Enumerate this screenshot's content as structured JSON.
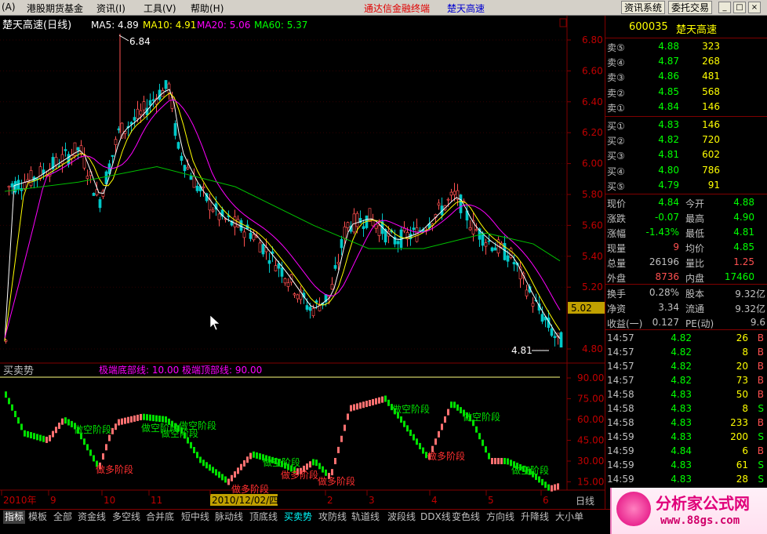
{
  "menubar": {
    "items": [
      "(A)",
      "港股期货基金",
      "资讯(I)",
      "工具(V)",
      "帮助(H)"
    ],
    "brand": "通达信金融终端",
    "stock_title": "楚天高速",
    "btn_info": "资讯系统",
    "btn_trade": "委托交易"
  },
  "chart": {
    "title": "楚天高速(日线)",
    "ma": [
      {
        "label": "MA5: 4.89",
        "color": "#ffffff"
      },
      {
        "label": "MA10: 4.91",
        "color": "#ffff00"
      },
      {
        "label": "MA20: 5.06",
        "color": "#ff00ff"
      },
      {
        "label": "MA60: 5.37",
        "color": "#00ff00"
      }
    ],
    "price_axis": [
      "6.80",
      "6.60",
      "6.40",
      "6.20",
      "6.00",
      "5.80",
      "5.60",
      "5.40",
      "5.20",
      "5.02",
      "4.80"
    ],
    "high_label": "6.84",
    "low_label": "4.81",
    "current_price": "5.02",
    "ind_title": "买卖势",
    "ind_params": "极端底部线: 10.00  极端顶部线: 90.00",
    "ind_axis": [
      "90.00",
      "75.00",
      "60.00",
      "45.00",
      "30.00",
      "15.00"
    ],
    "ind_labels": {
      "sell_phase": "做空阶段",
      "buy_phase": "做多阶段"
    },
    "date_axis": [
      "2010年",
      "9",
      "10",
      "11",
      "2010/12/02/四",
      "2",
      "3",
      "4",
      "5",
      "6"
    ],
    "period": "日线"
  },
  "quote": {
    "code": "600035",
    "name": "楚天高速",
    "asks": [
      {
        "label": "卖⑤",
        "price": "4.88",
        "vol": "323"
      },
      {
        "label": "卖④",
        "price": "4.87",
        "vol": "268"
      },
      {
        "label": "卖③",
        "price": "4.86",
        "vol": "481"
      },
      {
        "label": "卖②",
        "price": "4.85",
        "vol": "568"
      },
      {
        "label": "卖①",
        "price": "4.84",
        "vol": "146"
      }
    ],
    "bids": [
      {
        "label": "买①",
        "price": "4.83",
        "vol": "146"
      },
      {
        "label": "买②",
        "price": "4.82",
        "vol": "720"
      },
      {
        "label": "买③",
        "price": "4.81",
        "vol": "602"
      },
      {
        "label": "买④",
        "price": "4.80",
        "vol": "786"
      },
      {
        "label": "买⑤",
        "price": "4.79",
        "vol": "91"
      }
    ],
    "stats": [
      {
        "k1": "现价",
        "v1": "4.84",
        "c1": "#00ff00",
        "k2": "今开",
        "v2": "4.88",
        "c2": "#00ff00"
      },
      {
        "k1": "涨跌",
        "v1": "-0.07",
        "c1": "#00ff00",
        "k2": "最高",
        "v2": "4.90",
        "c2": "#00ff00"
      },
      {
        "k1": "涨幅",
        "v1": "-1.43%",
        "c1": "#00ff00",
        "k2": "最低",
        "v2": "4.81",
        "c2": "#00ff00"
      },
      {
        "k1": "现量",
        "v1": "9",
        "c1": "#ff5050",
        "k2": "均价",
        "v2": "4.85",
        "c2": "#00ff00"
      },
      {
        "k1": "总量",
        "v1": "26196",
        "c1": "#c0c0c0",
        "k2": "量比",
        "v2": "1.25",
        "c2": "#ff5050"
      },
      {
        "k1": "外盘",
        "v1": "8736",
        "c1": "#ff5050",
        "k2": "内盘",
        "v2": "17460",
        "c2": "#00ff00"
      }
    ],
    "fin": [
      {
        "k1": "换手",
        "v1": "0.28%",
        "k2": "股本",
        "v2": "9.32亿"
      },
      {
        "k1": "净资",
        "v1": "3.34",
        "k2": "流通",
        "v2": "9.32亿"
      },
      {
        "k1": "收益(一)",
        "v1": "0.127",
        "k2": "PE(动)",
        "v2": "9.6"
      }
    ],
    "ticks": [
      {
        "t": "14:57",
        "p": "4.82",
        "v": "26",
        "d": "B"
      },
      {
        "t": "14:57",
        "p": "4.82",
        "v": "8",
        "d": "B"
      },
      {
        "t": "14:57",
        "p": "4.82",
        "v": "20",
        "d": "B"
      },
      {
        "t": "14:57",
        "p": "4.82",
        "v": "73",
        "d": "B"
      },
      {
        "t": "14:58",
        "p": "4.83",
        "v": "50",
        "d": "B"
      },
      {
        "t": "14:58",
        "p": "4.83",
        "v": "8",
        "d": "S"
      },
      {
        "t": "14:58",
        "p": "4.83",
        "v": "233",
        "d": "B"
      },
      {
        "t": "14:59",
        "p": "4.83",
        "v": "200",
        "d": "S"
      },
      {
        "t": "14:59",
        "p": "4.84",
        "v": "6",
        "d": "B"
      },
      {
        "t": "14:59",
        "p": "4.83",
        "v": "61",
        "d": "S"
      },
      {
        "t": "14:59",
        "p": "4.83",
        "v": "28",
        "d": "S"
      }
    ]
  },
  "tabs": [
    "指标",
    "模板",
    "全部",
    "资金线",
    "多空线",
    "合并底",
    "短中线",
    "脉动线",
    "顶底线",
    "买卖势",
    "攻防线",
    "轨道线",
    "波段线",
    "DDX线",
    "变色线",
    "方向线",
    "升降线",
    "大小单"
  ],
  "active_tab": "买卖势",
  "logo": {
    "title": "分析家公式网",
    "url": "www.88gs.com"
  }
}
